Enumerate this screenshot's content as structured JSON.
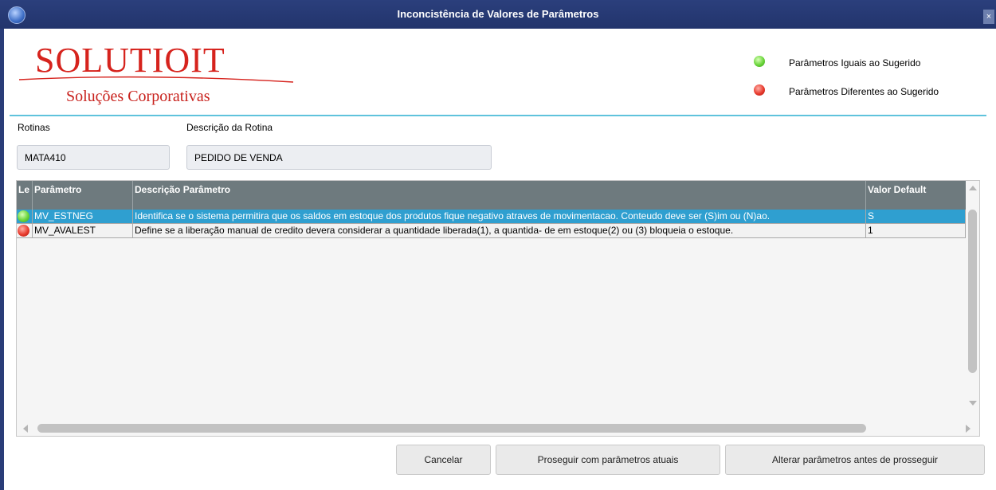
{
  "window": {
    "title": "Inconcistência de Valores de Parâmetros",
    "close_glyph": "×"
  },
  "logo": {
    "brand": "SOLUTIOIT",
    "tagline": "Soluções Corporativas"
  },
  "legend": [
    {
      "label": "Parâmetros Iguais ao Sugerido",
      "color": "#5ccc3a"
    },
    {
      "label": "Parâmetros Diferentes ao Sugerido",
      "color": "#e0362a"
    }
  ],
  "form": {
    "rotinas_label": "Rotinas",
    "rotinas_value": "MATA410",
    "descricao_label": "Descrição da Rotina",
    "descricao_value": "PEDIDO DE VENDA"
  },
  "grid": {
    "columns": [
      "Le",
      "Parâmetro",
      "Descrição Parâmetro",
      "Valor Default"
    ],
    "rows": [
      {
        "status": "green",
        "parametro": "MV_ESTNEG",
        "descricao": "Identifica se o sistema permitira que os saldos em estoque dos produtos fique negativo atraves de movimentacao. Conteudo deve ser (S)im ou (N)ao.",
        "valor": "S",
        "selected": true
      },
      {
        "status": "red",
        "parametro": "MV_AVALEST",
        "descricao": "Define se a liberação manual de credito devera considerar a quantidade liberada(1), a quantida- de em estoque(2) ou (3) bloqueia o estoque.",
        "valor": "1",
        "selected": false
      }
    ]
  },
  "buttons": {
    "cancel": "Cancelar",
    "proceed": "Proseguir com parâmetros atuais",
    "change": "Alterar parâmetros antes de prosseguir"
  },
  "colors": {
    "titlebar": "#22346c",
    "selected_row": "#2f9fd0",
    "header": "#6e7a7e",
    "brand_red": "#d6231d",
    "separator": "#5fc3dc"
  }
}
